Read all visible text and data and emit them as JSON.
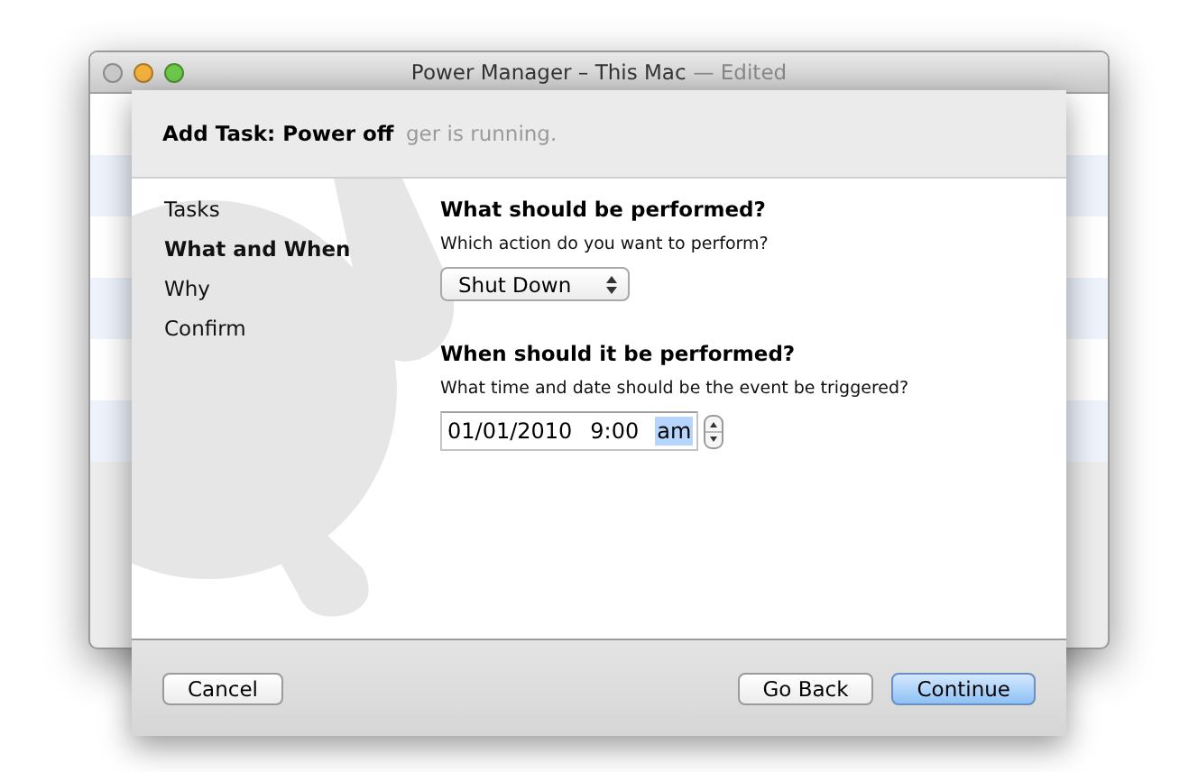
{
  "window": {
    "title": "Power Manager – This Mac",
    "edited_label": "— Edited",
    "background_text": "ger is running."
  },
  "sheet": {
    "title": "Add Task: Power off",
    "steps": [
      {
        "label": "Tasks",
        "selected": false
      },
      {
        "label": "What and When",
        "selected": true
      },
      {
        "label": "Why",
        "selected": false
      },
      {
        "label": "Confirm",
        "selected": false
      }
    ],
    "action_section": {
      "heading": "What should be performed?",
      "prompt": "Which action do you want to perform?",
      "popup_value": "Shut Down"
    },
    "time_section": {
      "heading": "When should it be performed?",
      "prompt": "What time and date should be the event be triggered?",
      "segments": [
        {
          "text": "01/01/2010",
          "selected": false
        },
        {
          "text": "9:00",
          "selected": false
        },
        {
          "text": "am",
          "selected": true
        }
      ]
    },
    "buttons": [
      {
        "label": "Cancel",
        "default": false
      },
      {
        "label": "Go Back",
        "default": false
      },
      {
        "label": "Continue",
        "default": true
      }
    ]
  }
}
